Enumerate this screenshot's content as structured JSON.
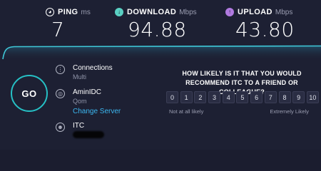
{
  "metrics": {
    "ping": {
      "label": "PING",
      "unit": "ms",
      "value": "7"
    },
    "download": {
      "label": "DOWNLOAD",
      "unit": "Mbps",
      "value": "94.88"
    },
    "upload": {
      "label": "UPLOAD",
      "unit": "Mbps",
      "value": "43.80"
    }
  },
  "go_button": {
    "label": "GO"
  },
  "connections": {
    "title": "Connections",
    "value": "Multi"
  },
  "server": {
    "name": "AminIDC",
    "location": "Qom",
    "change_link": "Change Server"
  },
  "isp": {
    "name": "ITC"
  },
  "survey": {
    "question": "HOW LIKELY IS IT THAT YOU WOULD RECOMMEND ITC TO A FRIEND OR COLLEAGUE?",
    "scale": [
      "0",
      "1",
      "2",
      "3",
      "4",
      "5",
      "6",
      "7",
      "8",
      "9",
      "10"
    ],
    "low_label": "Not at all likely",
    "high_label": "Extremely Likely"
  },
  "colors": {
    "background": "#1d2033",
    "download_accent": "#5ad0c3",
    "upload_accent": "#b07ae0",
    "go_ring": "#26c0c5",
    "link": "#3cb7f0"
  },
  "icons": {
    "ping": "ping-gauge-icon",
    "download": "download-arrow-icon",
    "upload": "upload-arrow-icon",
    "connections": "connections-icon",
    "server": "globe-icon",
    "isp": "person-icon"
  }
}
